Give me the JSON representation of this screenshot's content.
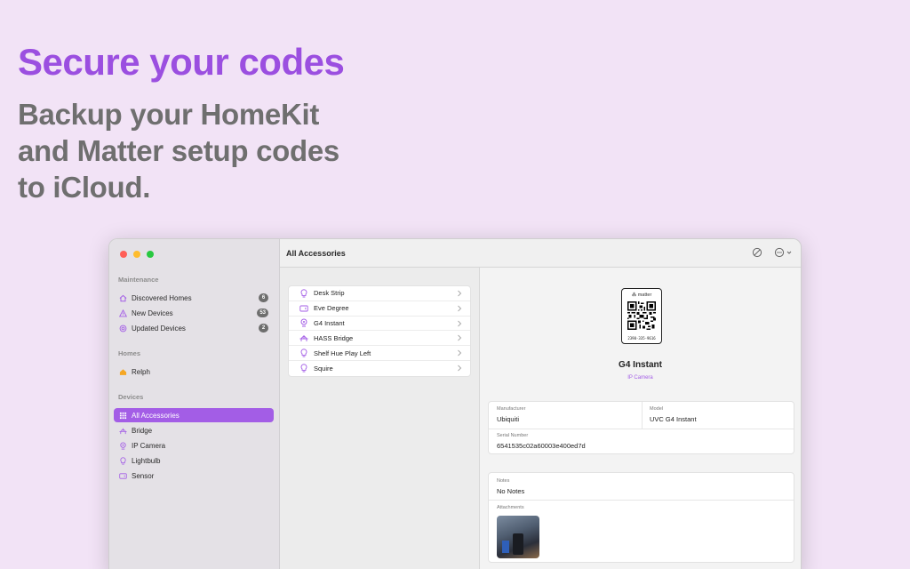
{
  "hero": {
    "title": "Secure your codes",
    "subtitle_lines": [
      "Backup your HomeKit",
      "and Matter setup codes",
      "to iCloud."
    ]
  },
  "colors": {
    "accent": "#a35de6",
    "hero_title": "#9b4fe0",
    "hero_sub": "#6f6f6f"
  },
  "sidebar": {
    "maintenance_header": "Maintenance",
    "maintenance_items": [
      {
        "label": "Discovered Homes",
        "badge": "6",
        "icon": "house-icon"
      },
      {
        "label": "New Devices",
        "badge": "53",
        "icon": "warning-icon"
      },
      {
        "label": "Updated Devices",
        "badge": "2",
        "icon": "refresh-icon"
      }
    ],
    "homes_header": "Homes",
    "home_items": [
      {
        "label": "Relph",
        "icon": "house-icon"
      }
    ],
    "devices_header": "Devices",
    "device_items": [
      {
        "label": "All Accessories",
        "icon": "grid-icon",
        "active": true
      },
      {
        "label": "Bridge",
        "icon": "bridge-icon"
      },
      {
        "label": "IP Camera",
        "icon": "camera-icon"
      },
      {
        "label": "Lightbulb",
        "icon": "lightbulb-icon"
      },
      {
        "label": "Sensor",
        "icon": "sensor-icon"
      }
    ]
  },
  "toolbar": {
    "title": "All Accessories"
  },
  "accessories": [
    {
      "label": "Desk Strip",
      "icon": "lightbulb-icon"
    },
    {
      "label": "Eve Degree",
      "icon": "sensor-icon"
    },
    {
      "label": "G4 Instant",
      "icon": "camera-icon"
    },
    {
      "label": "HASS Bridge",
      "icon": "bridge-icon"
    },
    {
      "label": "Shelf Hue Play Left",
      "icon": "lightbulb-icon"
    },
    {
      "label": "Squire",
      "icon": "lightbulb-icon"
    }
  ],
  "detail": {
    "qr_brand": "matter",
    "qr_code_number": "2390-335-9616",
    "name": "G4 Instant",
    "type": "IP Camera",
    "manufacturer_label": "Manufacturer",
    "manufacturer": "Ubiquiti",
    "model_label": "Model",
    "model": "UVC G4 Instant",
    "serial_label": "Serial Number",
    "serial": "6541535c02a60003e400ed7d",
    "notes_label": "Notes",
    "notes": "No Notes",
    "attachments_label": "Attachments"
  }
}
